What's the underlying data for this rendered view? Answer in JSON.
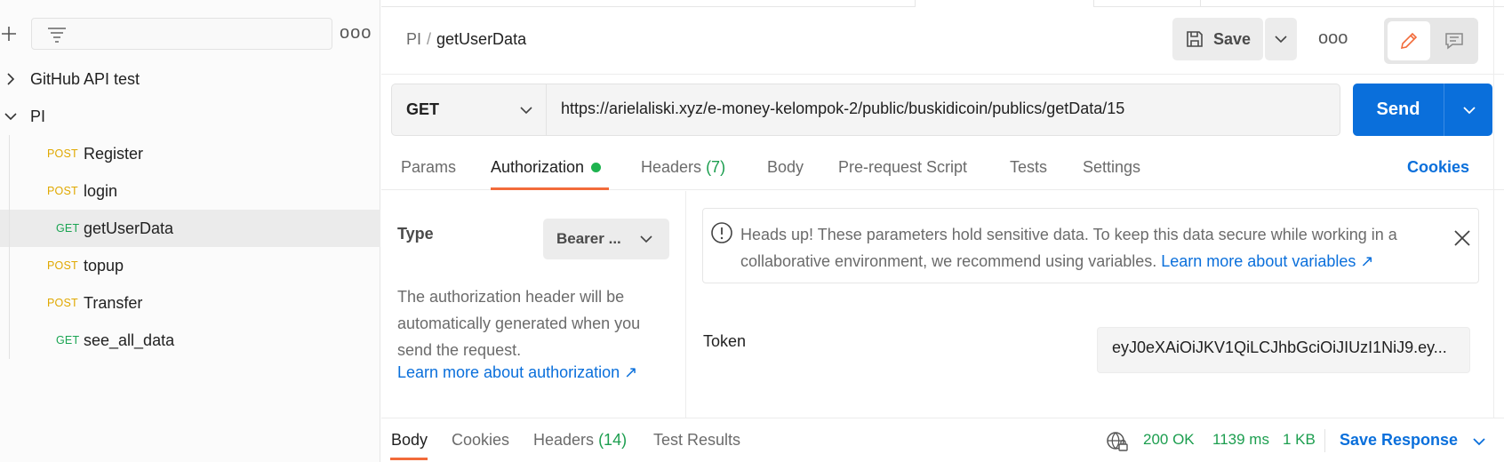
{
  "sidebar": {
    "new_icon": "plus-icon",
    "filter_icon": "filter-icon",
    "more_label": "ooo",
    "collections": [
      {
        "name": "GitHub API test",
        "expanded": false
      },
      {
        "name": "PI",
        "expanded": true
      }
    ],
    "requests": [
      {
        "method": "POST",
        "name": "Register"
      },
      {
        "method": "POST",
        "name": "login"
      },
      {
        "method": "GET",
        "name": "getUserData",
        "selected": true
      },
      {
        "method": "POST",
        "name": "topup"
      },
      {
        "method": "POST",
        "name": "Transfer"
      },
      {
        "method": "GET",
        "name": "see_all_data"
      }
    ]
  },
  "header": {
    "breadcrumb_parent": "PI",
    "breadcrumb_sep": "/",
    "breadcrumb_current": "getUserData",
    "save_label": "Save",
    "more_label": "ooo"
  },
  "request": {
    "method": "GET",
    "url": "https://arielaliski.xyz/e-money-kelompok-2/public/buskidicoin/publics/getData/15",
    "send_label": "Send"
  },
  "tabs": {
    "params": "Params",
    "authorization": "Authorization",
    "headers": "Headers",
    "headers_count": "(7)",
    "body": "Body",
    "prerequest": "Pre-request Script",
    "tests": "Tests",
    "settings": "Settings",
    "cookies": "Cookies"
  },
  "auth": {
    "type_label": "Type",
    "type_value": "Bearer ...",
    "description": "The authorization header will be automatically generated when you send the request.",
    "learn_more": "Learn more about authorization ↗",
    "warning_text": "Heads up! These parameters hold sensitive data. To keep this data secure while working in a collaborative environment, we recommend using variables.",
    "warning_link": "Learn more about variables ↗",
    "token_label": "Token",
    "token_value": "eyJ0eXAiOiJKV1QiLCJhbGciOiJIUzI1NiJ9.ey..."
  },
  "response": {
    "tabs": {
      "body": "Body",
      "cookies": "Cookies",
      "headers": "Headers",
      "headers_count": "(14)",
      "test_results": "Test Results"
    },
    "status": "200 OK",
    "time": "1139 ms",
    "size": "1 KB",
    "save_response": "Save Response"
  },
  "colors": {
    "accent": "#0a6fdb",
    "tab_underline": "#f26b3a",
    "post": "#e0a800",
    "get": "#1aa452",
    "success": "#1c9e4f"
  }
}
